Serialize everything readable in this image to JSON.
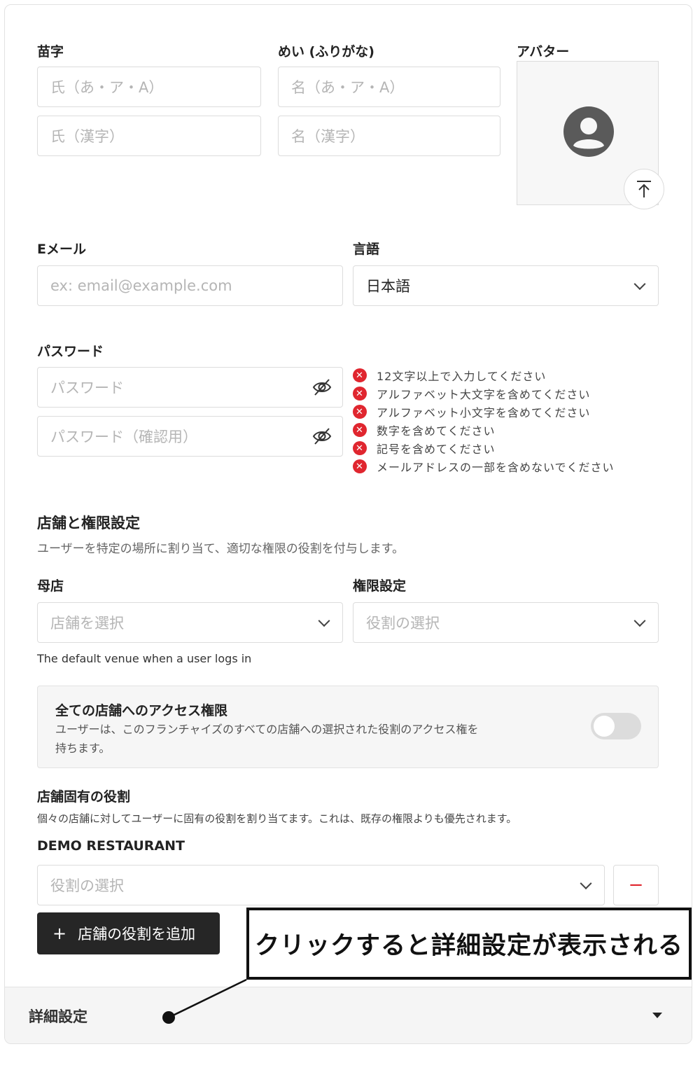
{
  "name_section": {
    "surname_label": "苗字",
    "given_label": "めい (ふりがな)",
    "avatar_label": "アバター",
    "surname_kana_placeholder": "氏（あ・ア・A）",
    "given_kana_placeholder": "名（あ・ア・A）",
    "surname_kanji_placeholder": "氏（漢字）",
    "given_kanji_placeholder": "名（漢字）"
  },
  "contact": {
    "email_label": "Eメール",
    "email_placeholder": "ex: email@example.com",
    "language_label": "言語",
    "language_value": "日本語"
  },
  "password": {
    "label": "パスワード",
    "placeholder": "パスワード",
    "confirm_placeholder": "パスワード（確認用）",
    "rules": [
      "12文字以上で入力してください",
      "アルファベット大文字を含めてください",
      "アルファベット小文字を含めてください",
      "数字を含めてください",
      "記号を含めてください",
      "メールアドレスの一部を含めないでください"
    ]
  },
  "venue_permissions": {
    "title": "店舗と権限設定",
    "description": "ユーザーを特定の場所に割り当て、適切な権限の役割を付与します。",
    "home_venue_label": "母店",
    "home_venue_placeholder": "店舗を選択",
    "role_label": "権限設定",
    "role_placeholder": "役割の選択",
    "default_venue_note": "The default venue when a user logs in"
  },
  "all_access": {
    "title": "全ての店舗へのアクセス権限",
    "description_line1": "ユーザーは、このフランチャイズのすべての店舗への選択された役割のアクセス権を",
    "description_line2": "持ちます。",
    "enabled": false
  },
  "venue_roles": {
    "title": "店舗固有の役割",
    "description": "個々の店舗に対してユーザーに固有の役割を割り当てます。これは、既存の権限よりも優先されます。",
    "venue_name": "DEMO RESTAURANT",
    "role_placeholder": "役割の選択",
    "remove_symbol": "−",
    "add_button_label": "店舗の役割を追加",
    "add_symbol": "+"
  },
  "advanced": {
    "label": "詳細設定"
  },
  "annotation": {
    "callout_text": "クリックすると詳細設定が表示される"
  },
  "colors": {
    "error": "#e0262f",
    "button_dark": "#262626",
    "border": "#dcdcdc"
  }
}
